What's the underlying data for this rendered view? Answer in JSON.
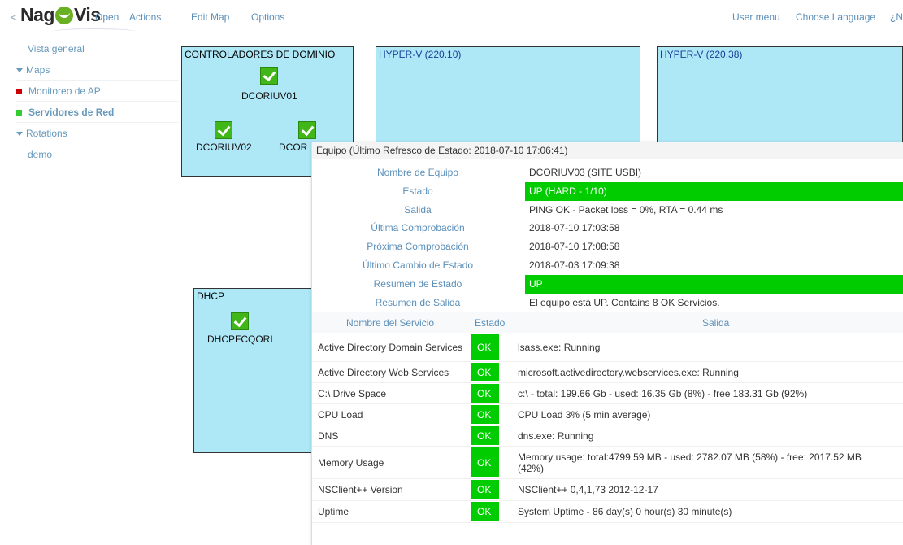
{
  "header": {
    "back": "<",
    "logo_nag": "Nag",
    "logo_vis": "Vis",
    "menu": [
      "Open",
      "Actions",
      "Edit Map",
      "Options"
    ],
    "user_menu": "User menu",
    "choose_language": "Choose Language",
    "help_truncated": "¿N"
  },
  "sidebar": {
    "overview": "Vista general",
    "maps_label": "Maps",
    "maps": [
      {
        "label": "Monitoreo de AP",
        "status_color": "#cc0000"
      },
      {
        "label": "Servidores de Red",
        "status_color": "#33cc33"
      }
    ],
    "rotations_label": "Rotations",
    "rotations": [
      "demo"
    ]
  },
  "map": {
    "boxes": [
      {
        "title": "CONTROLADORES DE DOMINIO"
      },
      {
        "title": "HYPER-V (220.10)"
      },
      {
        "title": "HYPER-V (220.38)"
      },
      {
        "title": "DHCP"
      }
    ],
    "hosts": [
      "DCORIUV01",
      "DCORIUV02",
      "DCOR",
      "DHCPFCQORI"
    ]
  },
  "popup": {
    "header": "Equipo (Último Refresco de Estado: 2018-07-10 17:06:41)",
    "rows": [
      {
        "label": "Nombre de Equipo",
        "value": "DCORIUV03 (SITE USBI)"
      },
      {
        "label": "Estado",
        "value": "UP (HARD - 1/10)"
      },
      {
        "label": "Salida",
        "value": "PING OK - Packet loss = 0%, RTA = 0.44 ms"
      },
      {
        "label": "Última Comprobación",
        "value": "2018-07-10 17:03:58"
      },
      {
        "label": "Próxima Comprobación",
        "value": "2018-07-10 17:08:58"
      },
      {
        "label": "Último Cambio de Estado",
        "value": "2018-07-03 17:09:38"
      },
      {
        "label": "Resumen de Estado",
        "value": "UP"
      },
      {
        "label": "Resumen de Salida",
        "value": "El equipo está UP. Contains 8 OK Servicios."
      }
    ],
    "service_columns": [
      "Nombre del Servicio",
      "Estado",
      "Salida"
    ],
    "services": [
      {
        "name": "Active Directory Domain Services",
        "state": "OK",
        "output": "lsass.exe: Running"
      },
      {
        "name": "Active Directory Web Services",
        "state": "OK",
        "output": "microsoft.activedirectory.webservices.exe: Running"
      },
      {
        "name": "C:\\ Drive Space",
        "state": "OK",
        "output": "c:\\ - total: 199.66 Gb - used: 16.35 Gb (8%) - free 183.31 Gb (92%)"
      },
      {
        "name": "CPU Load",
        "state": "OK",
        "output": "CPU Load 3% (5 min average)"
      },
      {
        "name": "DNS",
        "state": "OK",
        "output": "dns.exe: Running"
      },
      {
        "name": "Memory Usage",
        "state": "OK",
        "output": "Memory usage: total:4799.59 MB - used: 2782.07 MB (58%) - free: 2017.52 MB (42%)"
      },
      {
        "name": "NSClient++ Version",
        "state": "OK",
        "output": "NSClient++ 0,4,1,73 2012-12-17"
      },
      {
        "name": "Uptime",
        "state": "OK",
        "output": "System Uptime - 86 day(s) 0 hour(s) 30 minute(s)"
      }
    ],
    "status_green": "#00cc00"
  }
}
